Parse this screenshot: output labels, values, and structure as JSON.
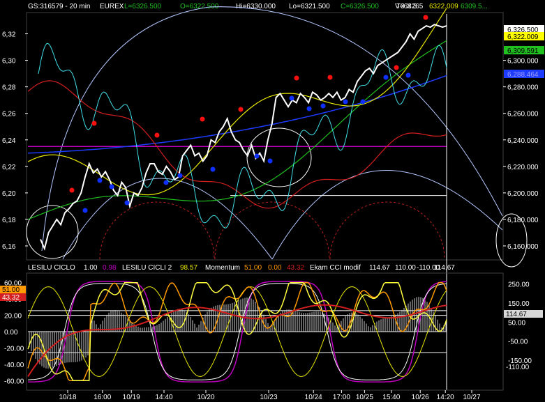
{
  "header": {
    "symbol": "GS:316579 - 20 min",
    "exchange": "EUREX",
    "last": "L=6326.500",
    "open": "O=6322.500",
    "high": "Hi=6330.000",
    "low": "Lo=6321.500",
    "close": "C=6326.500",
    "volume": "V=63265",
    "t3": "T3 X 3",
    "t3_val1": "6322.009",
    "t3_val2": "6309.5..."
  },
  "lower_header": {
    "ciclo_name": "LESILU CICLO",
    "ciclo_v1": "1.00",
    "ciclo_v2": "0.98",
    "cicli2_name": "LESILU CICLI 2",
    "cicli2_v": "98.57",
    "momentum_name": "Momentum",
    "mom_v1": "51.00",
    "mom_v2": "0.00",
    "mom_v3": "43.32",
    "cci_name": "Ekam CCI modif",
    "cci_v1": "114.67",
    "cci_v2": "110.00",
    "cci_v3": "-110.00",
    "cci_v4": "114.67"
  },
  "colors": {
    "price": "#ffffff",
    "cyan": "#40e0e8",
    "red": "#d21e1e",
    "yellow": "#e8e800",
    "green": "#20c020",
    "blue": "#1e3cff",
    "magenta": "#c000c0",
    "orange": "#ff9a00",
    "arc": "#b4c8ff"
  },
  "chart_data": [
    {
      "type": "line",
      "panel": "price",
      "y_ticks_left": [
        "6,32",
        "6,30",
        "6,28",
        "6,26",
        "6,24",
        "6,22",
        "6,20",
        "6,18",
        "6,16"
      ],
      "y_ticks_right": [
        "6,300.000",
        "6,280.000",
        "6,260.000",
        "6,240.000",
        "6,220.000",
        "6,200.000",
        "6,180.000",
        "6,160.000"
      ],
      "ylim": [
        6150,
        6335
      ],
      "right_labels": [
        {
          "text": "6,326.500",
          "value": 6326.5,
          "bg": "#ffffff",
          "fg": "#000000"
        },
        {
          "text": "6,322.009",
          "value": 6322,
          "bg": "#ffff00",
          "fg": "#000000"
        },
        {
          "text": "6,309.591",
          "value": 6309.6,
          "bg": "#20c020",
          "fg": "#000000"
        },
        {
          "text": "6,288.464",
          "value": 6288.5,
          "bg": "#1e3cff",
          "fg": "#a0a0ff"
        }
      ],
      "horizontal_level": 6235,
      "support_level": 6198,
      "series": [
        {
          "x": [
            0,
            2,
            4,
            6,
            8,
            10,
            12,
            14,
            16,
            18,
            20,
            22,
            24,
            26,
            28,
            30,
            32,
            34,
            36,
            38,
            40,
            42,
            44,
            46,
            48,
            50,
            52,
            54,
            56,
            58,
            60,
            62,
            64,
            66,
            68,
            70,
            72,
            74,
            76,
            78,
            80,
            82,
            84,
            86,
            88,
            90,
            92,
            94,
            96,
            98,
            100,
            102,
            104,
            106,
            108,
            110,
            112,
            114,
            116,
            118,
            120,
            122,
            124,
            126,
            128,
            130,
            132,
            134,
            136,
            138,
            140,
            142,
            144,
            146,
            148,
            150,
            152,
            154,
            156,
            158,
            160,
            162,
            164,
            166,
            168,
            170,
            172,
            174,
            176,
            178,
            180,
            182,
            184,
            186,
            188,
            190,
            192,
            194,
            196,
            198,
            200
          ],
          "values": [
            6165,
            6158,
            6170,
            6175,
            6180,
            6176,
            6185,
            6188,
            6192,
            6194,
            6200,
            6212,
            6222,
            6215,
            6218,
            6212,
            6216,
            6210,
            6202,
            6198,
            6208,
            6204,
            6190,
            6200,
            6198,
            6204,
            6215,
            6222,
            6222,
            6216,
            6214,
            6220,
            6216,
            6210,
            6212,
            6228,
            6232,
            6236,
            6228,
            6230,
            6224,
            6228,
            6240,
            6238,
            6246,
            6250,
            6256,
            6246,
            6240,
            6238,
            6232,
            6228,
            6236,
            6226,
            6230,
            6224,
            6240,
            6252,
            6272,
            6275,
            6270,
            6265,
            6270,
            6268,
            6275,
            6272,
            6268,
            6276,
            6274,
            6270,
            6272,
            6275,
            6272,
            6276,
            6270,
            6272,
            6278,
            6276,
            6284,
            6288,
            6292,
            6294,
            6290,
            6296,
            6298,
            6300,
            6302,
            6304,
            6306,
            6310,
            6314,
            6320,
            6316,
            6322,
            6324,
            6326,
            6325,
            6327,
            6326,
            6325,
            6326
          ]
        }
      ]
    },
    {
      "type": "line",
      "panel": "oscillator",
      "y_ticks_left": [
        "60.00",
        "40.00",
        "20.00",
        "0.00",
        "-20.00",
        "-40.00",
        "-60.00"
      ],
      "y_ticks_right": [
        "250.00",
        "150.00",
        "50.00",
        "-50.00",
        "-150.00"
      ],
      "value_tags": [
        {
          "text": "51.00",
          "bg": "#ff9a00",
          "fg": "#000000"
        },
        {
          "text": "43.32",
          "bg": "#d21e1e",
          "fg": "#ffffff"
        },
        {
          "text": "114.67",
          "bg": "#d8d8d8",
          "fg": "#000000"
        },
        {
          "text": "-110.00",
          "bg": "#000000",
          "fg": "#ffffff"
        }
      ],
      "levels": [
        110,
        -110
      ],
      "ylim": [
        -70,
        70
      ]
    }
  ],
  "x_axis": {
    "ticks": [
      {
        "label": "10/18",
        "pos": 0.095
      },
      {
        "label": "16:00",
        "pos": 0.178
      },
      {
        "label": "10/19",
        "pos": 0.247
      },
      {
        "label": "14:40",
        "pos": 0.325
      },
      {
        "label": "10/20",
        "pos": 0.425
      },
      {
        "label": "10/23",
        "pos": 0.575
      },
      {
        "label": "10/24",
        "pos": 0.682
      },
      {
        "label": "17:00",
        "pos": 0.749
      },
      {
        "label": "10/25",
        "pos": 0.804
      },
      {
        "label": "15:40",
        "pos": 0.868
      },
      {
        "label": "10/26",
        "pos": 0.937
      },
      {
        "label": "14:20",
        "pos": 0.997
      },
      {
        "label": "10/27",
        "pos": 1.06
      }
    ]
  }
}
